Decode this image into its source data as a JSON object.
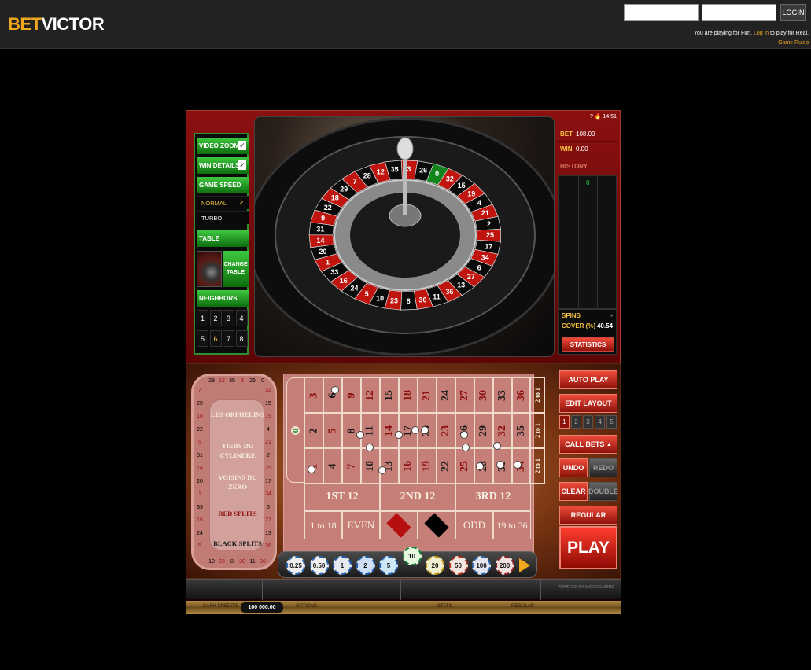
{
  "site": {
    "logo_bet": "BET",
    "logo_victor": "VICTOR",
    "login_label": "LOGIN",
    "playing_prefix": "You are playing for Fun.",
    "playing_link": "Log in",
    "playing_suffix": "to play for Real.",
    "rules_link": "Game Rules"
  },
  "status": {
    "help": "?",
    "time": "14:51"
  },
  "options": {
    "video_zoom": "VIDEO ZOOM",
    "win_details": "WIN DETAILS",
    "game_speed": "GAME SPEED",
    "normal": "NORMAL",
    "turbo": "TURBO",
    "table": "TABLE",
    "change_table": "CHANGE TABLE",
    "neighbors": "NEIGHBORS",
    "neighbor_values": [
      "1",
      "2",
      "3",
      "4",
      "5",
      "6",
      "7",
      "8"
    ],
    "neighbor_selected": "6",
    "check": "✓"
  },
  "info": {
    "bet_label": "BET",
    "bet_value": "108.00",
    "win_label": "WIN",
    "win_value": "0.00",
    "history_label": "HISTORY",
    "history_entry": "0",
    "spins_label": "SPINS",
    "spins_value": "-",
    "cover_label": "COVER (%)",
    "cover_value": "40.54",
    "statistics": "STATISTICS"
  },
  "racetrack": {
    "top": [
      "28",
      "12",
      "35",
      "3",
      "26",
      "0"
    ],
    "left": [
      "7",
      "29",
      "18",
      "22",
      "9",
      "31",
      "14",
      "20",
      "1",
      "33",
      "16",
      "24",
      "5"
    ],
    "right": [
      "32",
      "15",
      "19",
      "4",
      "21",
      "2",
      "25",
      "17",
      "34",
      "6",
      "27",
      "13",
      "36"
    ],
    "bottom": [
      "10",
      "23",
      "8",
      "30",
      "11",
      "36"
    ],
    "labels": [
      "LES ORPHELINS",
      "TIERS DU CYLINDRE",
      "VOISINS DU ZERO",
      "RED SPLITS",
      "BLACK SPLITS"
    ]
  },
  "table": {
    "zero": "0",
    "top_row": [
      "3",
      "6",
      "9",
      "12",
      "15",
      "18",
      "21",
      "24",
      "27",
      "30",
      "33",
      "36"
    ],
    "mid_row": [
      "2",
      "5",
      "8",
      "11",
      "14",
      "17",
      "20",
      "23",
      "26",
      "29",
      "32",
      "35"
    ],
    "bot_row": [
      "1",
      "4",
      "7",
      "10",
      "13",
      "16",
      "19",
      "22",
      "25",
      "28",
      "31",
      "34"
    ],
    "red": [
      "1",
      "3",
      "5",
      "7",
      "9",
      "12",
      "14",
      "16",
      "18",
      "19",
      "21",
      "23",
      "25",
      "27",
      "30",
      "32",
      "34",
      "36"
    ],
    "column_bet": "2 to 1",
    "dozens": [
      "1ST 12",
      "2ND 12",
      "3RD 12"
    ],
    "outside": [
      "1 to 18",
      "EVEN",
      "ODD",
      "19 to 36"
    ],
    "colors": {
      "felt": "#c67f78",
      "red": "#b50f0f",
      "black": "#000000"
    }
  },
  "chips": {
    "values": [
      "0.25",
      "0.50",
      "1",
      "2",
      "5",
      "10",
      "20",
      "50",
      "100",
      "200"
    ],
    "selected": "10"
  },
  "buttons": {
    "auto_play": "AUTO PLAY",
    "edit_layout": "EDIT LAYOUT",
    "layouts": [
      "1",
      "2",
      "3",
      "4",
      "5"
    ],
    "call_bets": "CALL BETS",
    "undo": "UNDO",
    "redo": "REDO",
    "clear": "CLEAR",
    "double": "DOUBLE",
    "regular": "REGULAR",
    "play": "PLAY"
  },
  "footer": {
    "powered": "POWERED BY MICROGAMING",
    "credits_label": "CASH CREDITS",
    "credits_value": "100 000.00",
    "options": "OPTIONS",
    "stats": "STATS",
    "mode": "REGULAR"
  }
}
